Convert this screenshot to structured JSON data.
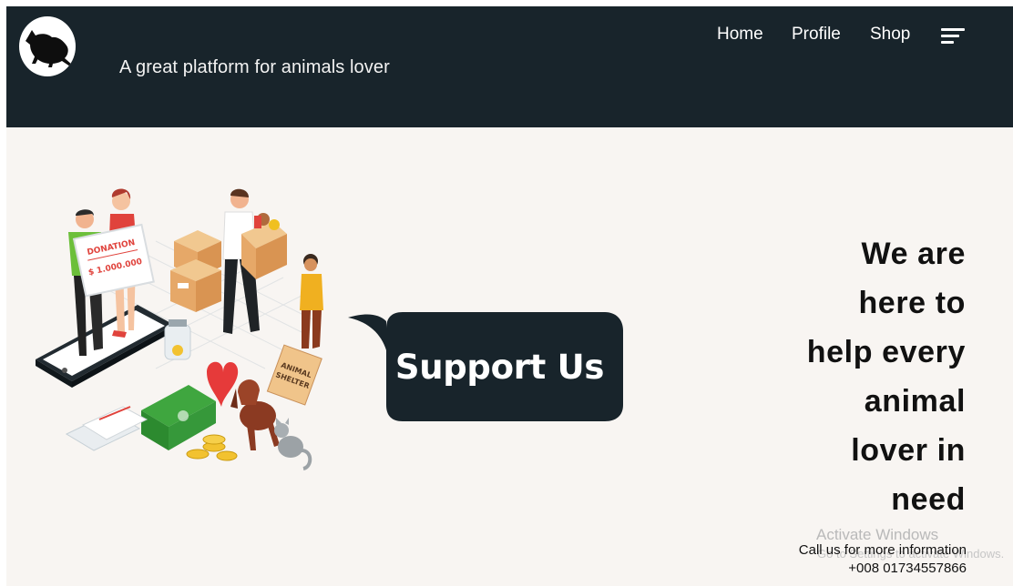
{
  "header": {
    "tagline": "A great platform for animals lover",
    "nav": {
      "home": "Home",
      "profile": "Profile",
      "shop": "Shop"
    },
    "menu_icon": "hamburger-icon",
    "logo_icon": "cat-logo-icon"
  },
  "hero": {
    "illustration": {
      "donation_sign": "DONATION",
      "donation_amount": "$ 1.000.000",
      "shelter_sign_line1": "ANIMAL",
      "shelter_sign_line2": "SHELTER"
    },
    "support_button": "Support Us",
    "headline_lines": [
      "We are",
      "here to",
      "help every",
      "animal",
      "lover in",
      "need"
    ]
  },
  "contact": {
    "line1": "Call us for more information",
    "phone": "+008 01734557866"
  },
  "watermark": {
    "line1": "Activate Windows",
    "line2": "Go to Settings to activate Windows."
  },
  "colors": {
    "header_bg": "#18242b",
    "page_bg": "#f8f5f2",
    "bubble_bg": "#18242b",
    "text_dark": "#111111"
  }
}
